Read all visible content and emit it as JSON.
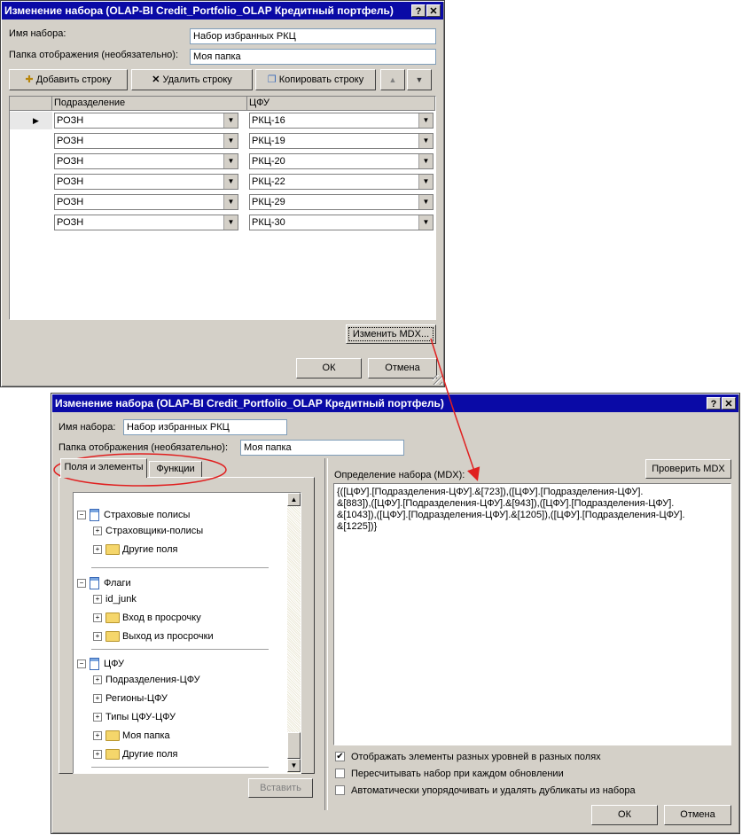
{
  "dialog1": {
    "title": "Изменение набора (OLAP-BI Credit_Portfolio_OLAP Кредитный портфель)",
    "set_name_label": "Имя набора:",
    "set_name_value": "Набор избранных РКЦ",
    "folder_label": "Папка отображения (необязательно):",
    "folder_value": "Моя папка",
    "toolbar": {
      "add_row": "Добавить строку",
      "delete_row": "Удалить строку",
      "copy_row": "Копировать строку"
    },
    "grid": {
      "col1": "Подразделение",
      "col2": "ЦФУ",
      "rows": [
        {
          "div": "РОЗН",
          "cfu": "РКЦ-16"
        },
        {
          "div": "РОЗН",
          "cfu": "РКЦ-19"
        },
        {
          "div": "РОЗН",
          "cfu": "РКЦ-20"
        },
        {
          "div": "РОЗН",
          "cfu": "РКЦ-22"
        },
        {
          "div": "РОЗН",
          "cfu": "РКЦ-29"
        },
        {
          "div": "РОЗН",
          "cfu": "РКЦ-30"
        }
      ]
    },
    "edit_mdx": "Изменить MDX...",
    "ok": "ОК",
    "cancel": "Отмена"
  },
  "dialog2": {
    "title": "Изменение набора (OLAP-BI Credit_Portfolio_OLAP Кредитный портфель)",
    "set_name_label": "Имя набора:",
    "set_name_value": "Набор избранных РКЦ",
    "folder_label": "Папка отображения (необязательно):",
    "folder_value": "Моя папка",
    "tabs": [
      "Поля и элементы",
      "Функции"
    ],
    "tree": {
      "g1": "Страховые полисы",
      "g1_items": [
        "Страховщики-полисы",
        "Другие поля"
      ],
      "g2": "Флаги",
      "g2_items": [
        "id_junk",
        "Вход в просрочку",
        "Выход из просрочки"
      ],
      "g3": "ЦФУ",
      "g3_items": [
        "Подразделения-ЦФУ",
        "Регионы-ЦФУ",
        "Типы ЦФУ-ЦФУ",
        "Моя папка",
        "Другие поля"
      ]
    },
    "insert": "Вставить",
    "def_label": "Определение набора (MDX):",
    "check_mdx": "Проверить MDX",
    "mdx_lines": [
      "{([ЦФУ].[Подразделения-ЦФУ].&[723]),([ЦФУ].[Подразделения-ЦФУ].",
      "&[883]),([ЦФУ].[Подразделения-ЦФУ].&[943]),([ЦФУ].[Подразделения-ЦФУ].",
      "&[1043]),([ЦФУ].[Подразделения-ЦФУ].&[1205]),([ЦФУ].[Подразделения-ЦФУ].",
      "&[1225])}"
    ],
    "options": [
      {
        "label": "Отображать элементы разных уровней в разных полях",
        "checked": true
      },
      {
        "label": "Пересчитывать набор при каждом обновлении",
        "checked": false
      },
      {
        "label": "Автоматически упорядочивать и удалять дубликаты из набора",
        "checked": false
      }
    ],
    "ok": "ОК",
    "cancel": "Отмена"
  },
  "colors": {
    "title_bar": "#0a0aa6",
    "annotation": "#e02020",
    "dialog_bg": "#d4d0c8"
  }
}
